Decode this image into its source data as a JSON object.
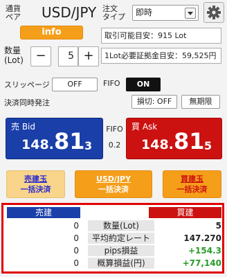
{
  "header": {
    "pair_label": "通貨ペア",
    "pair_label_l1": "通貨",
    "pair_label_l2": "ペア",
    "pair": "USD/JPY",
    "info_button": "info",
    "order_type_label_l1": "注文",
    "order_type_label_l2": "タイプ",
    "order_type_value": "即時",
    "settings_icon": "gear-icon"
  },
  "lot": {
    "label_l1": "数量",
    "label_l2": "(Lot)",
    "minus": "−",
    "value": "5",
    "plus": "+",
    "tradable": "取引可能目安：915 Lot",
    "margin": "1Lot必要証拠金目安：59,525円"
  },
  "toggles": {
    "slippage_label": "スリッページ",
    "slippage_value": "OFF",
    "fifo_label": "FIFO",
    "fifo_value": "ON",
    "settle_label": "決済同時発注",
    "stoploss_value": "損切: OFF",
    "expiry_value": "無期限"
  },
  "prices": {
    "bid_label": "売 Bid",
    "bid_main": "148.",
    "bid_big": "81",
    "bid_small": "3",
    "fifo": "FIFO",
    "spread": "0.2",
    "ask_label": "買 Ask",
    "ask_main": "148.",
    "ask_big": "81",
    "ask_small": "5"
  },
  "settle_buttons": {
    "sell_l1": "売建玉",
    "sell_l2": "一括決済",
    "pair_l1": "USD/JPY",
    "pair_l2": "一括決済",
    "buy_l1": "買建玉",
    "buy_l2": "一括決済"
  },
  "positions": {
    "sell_header": "売建",
    "buy_header": "買建",
    "rows": [
      {
        "label": "数量(Lot)",
        "sell": "0",
        "buy": "5"
      },
      {
        "label": "平均約定レート",
        "sell": "0",
        "buy": "147.270"
      },
      {
        "label": "pips損益",
        "sell": "0",
        "buy": "+154.3"
      },
      {
        "label": "概算損益(円)",
        "sell": "0",
        "buy": "+77,140"
      }
    ]
  },
  "colors": {
    "bid_blue": "#1a3fa8",
    "ask_red": "#cc1111",
    "accent_orange": "#f59e1a",
    "profit_green": "#2a9a2a",
    "highlight_red": "#e00000"
  }
}
